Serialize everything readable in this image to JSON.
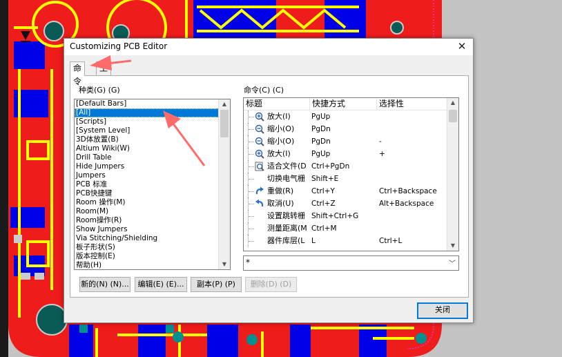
{
  "dialog": {
    "title": "Customizing PCB Editor",
    "close_glyph": "✕",
    "tabs": [
      {
        "label": "命令"
      },
      {
        "label": "工具栏"
      }
    ]
  },
  "categories": {
    "label": "种类(G)",
    "shortcut_hint": "(G)",
    "items": [
      "[Default Bars]",
      "[All]",
      "[Scripts]",
      "[System Level]",
      "3D体放置(B)",
      "Altium Wiki(W)",
      "Drill Table",
      "Hide Jumpers",
      "Jumpers",
      "PCB 标准",
      "PCB快捷键",
      "Room 操作(M)",
      "Room(M)",
      "Room操作(R)",
      "Show Jumpers",
      "Via Stitching/Shielding",
      "板子形状(S)",
      "版本控制(E)",
      "帮助(H)"
    ],
    "selected": "[All]"
  },
  "commands": {
    "label": "命令(C)",
    "shortcut_hint": "(C)",
    "columns": [
      "标题",
      "快捷方式",
      "选择性"
    ],
    "rows": [
      {
        "title": "放大(I)",
        "shortcut": "PgUp",
        "alt": "",
        "icon": "zoom-in-icon"
      },
      {
        "title": "缩小(O)",
        "shortcut": "PgDn",
        "alt": "",
        "icon": "zoom-out-icon"
      },
      {
        "title": "缩小(O)",
        "shortcut": "PgDn",
        "alt": "-",
        "icon": "zoom-out-icon"
      },
      {
        "title": "放大(I)",
        "shortcut": "PgUp",
        "alt": "+",
        "icon": "zoom-in-icon"
      },
      {
        "title": "适合文件(D",
        "shortcut": "Ctrl+PgDn",
        "alt": "",
        "icon": "fit-document-icon"
      },
      {
        "title": "切换电气栅",
        "shortcut": "Shift+E",
        "alt": "",
        "icon": ""
      },
      {
        "title": "重做(R)",
        "shortcut": "Ctrl+Y",
        "alt": "Ctrl+Backspace",
        "icon": "redo-icon"
      },
      {
        "title": "取消(U)",
        "shortcut": "Ctrl+Z",
        "alt": "Alt+Backspace",
        "icon": "undo-icon"
      },
      {
        "title": "设置跳转栅",
        "shortcut": "Shift+Ctrl+G",
        "alt": "",
        "icon": ""
      },
      {
        "title": "测量距离(M",
        "shortcut": "Ctrl+M",
        "alt": "",
        "icon": ""
      },
      {
        "title": "器件库层(L",
        "shortcut": "L",
        "alt": "Ctrl+L",
        "icon": ""
      }
    ],
    "filter_value": "*"
  },
  "buttons": {
    "new": "新的(N) (N)...",
    "edit": "编辑(E) (E)...",
    "copy": "副本(P) (P)",
    "delete": "删除(D) (D)",
    "close": "关闭"
  },
  "colors": {
    "pcb_red": "#ef1c1c",
    "pcb_yellow": "#ffff00",
    "pcb_blue": "#0000e6",
    "pcb_magenta": "#e23ee2",
    "selection": "#0078d7",
    "arrow": "#ff6a6a"
  }
}
